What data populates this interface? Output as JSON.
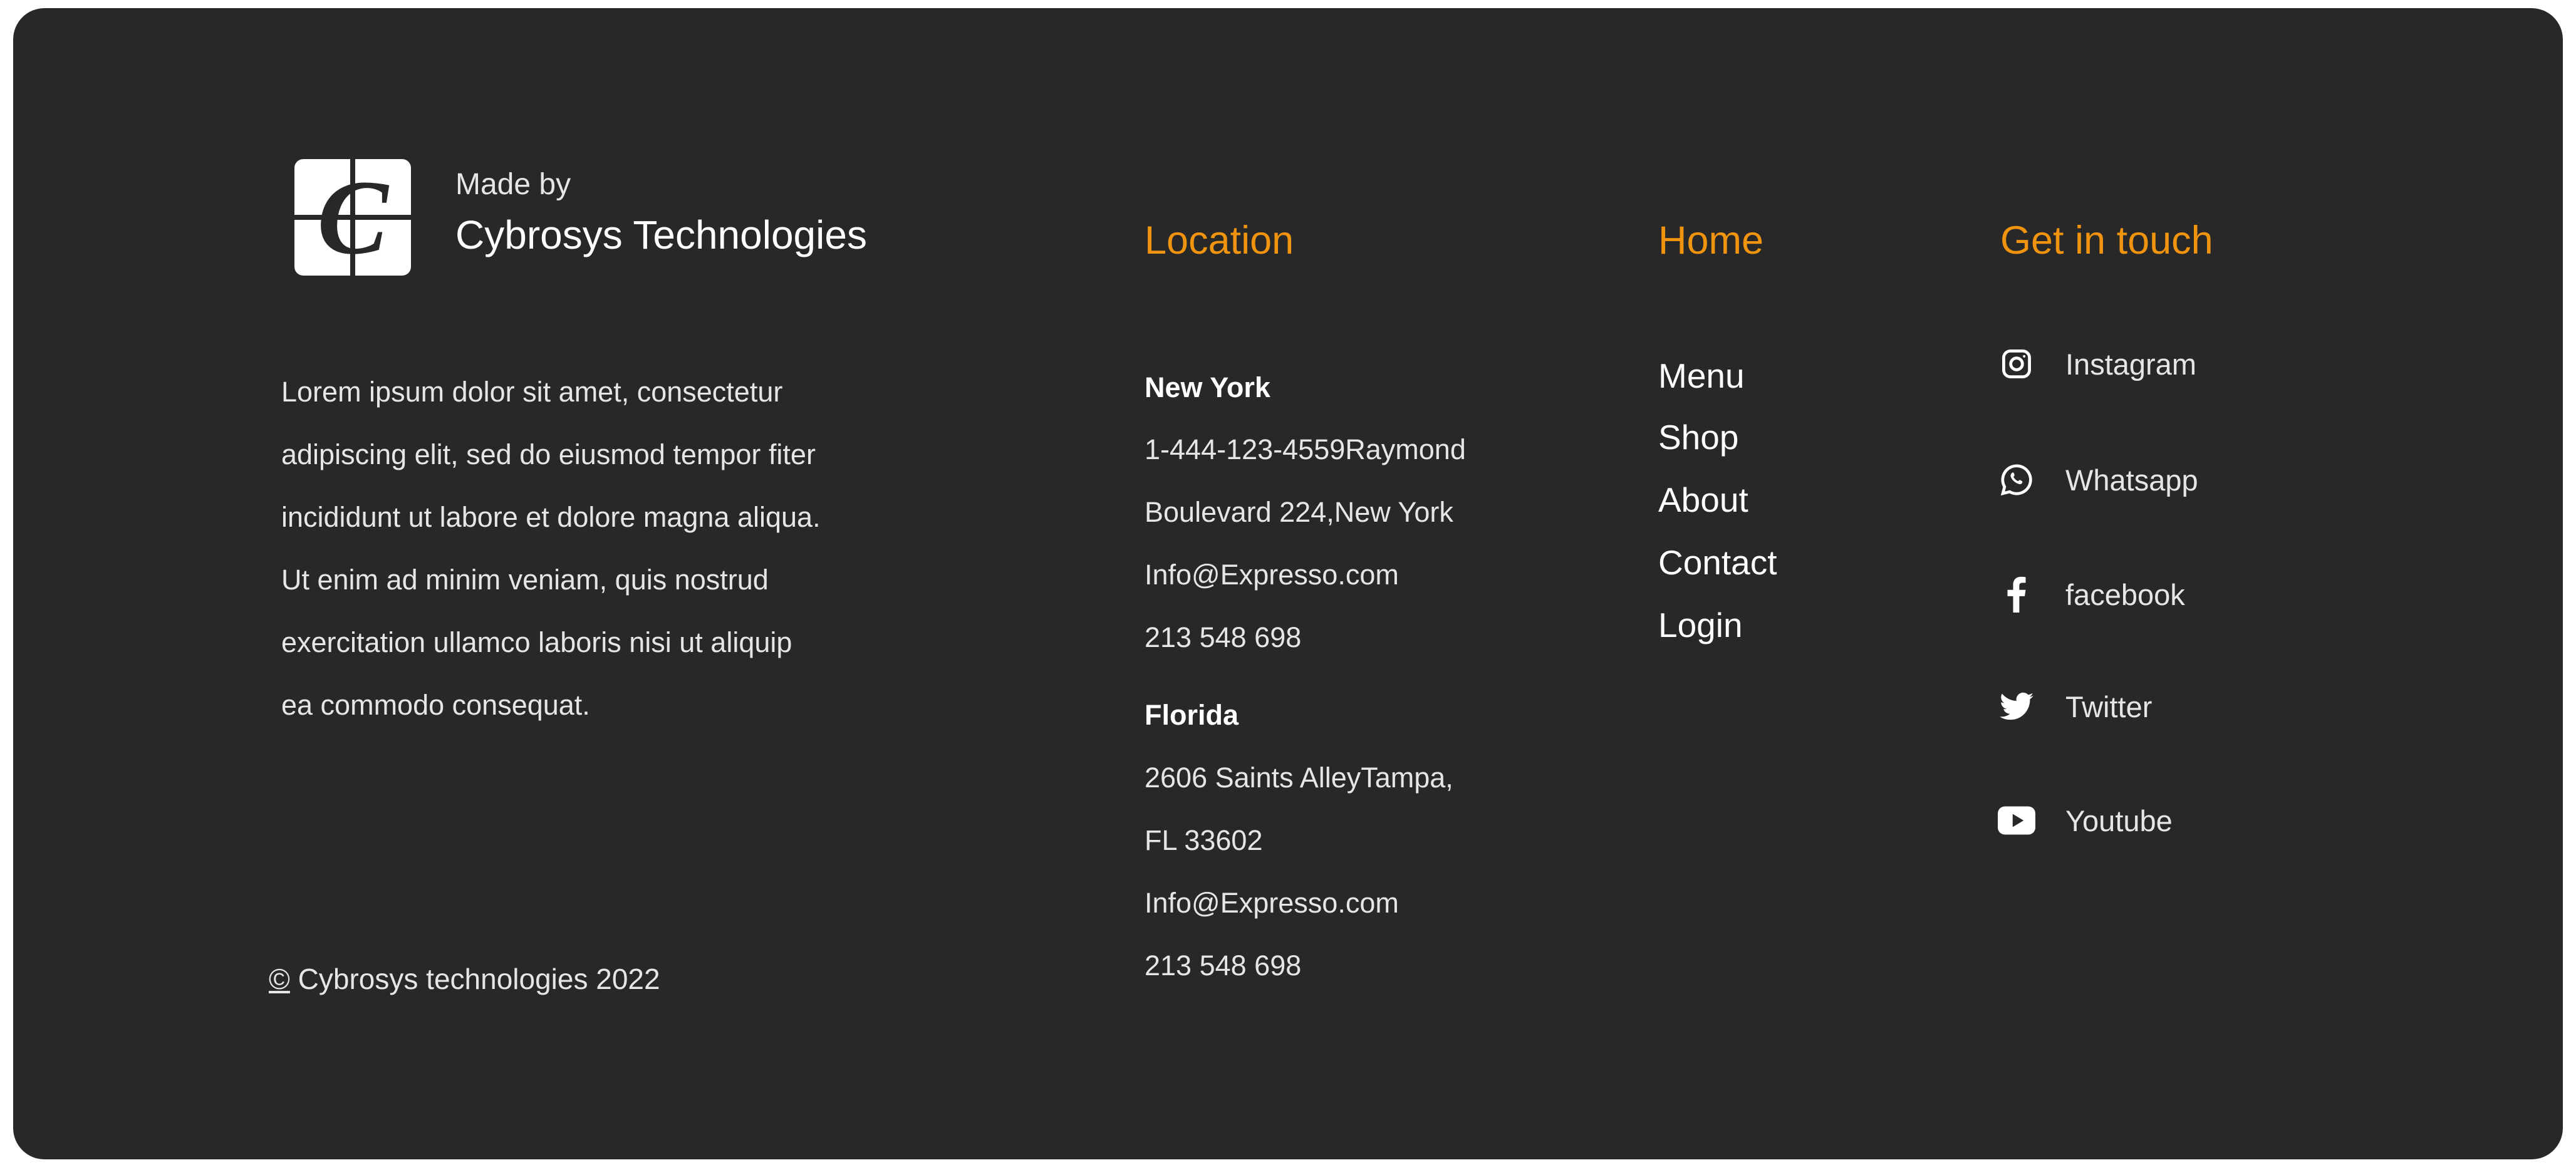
{
  "brand": {
    "made_by": "Made by",
    "name": "Cybrosys Technologies",
    "logo_letter": "C"
  },
  "about": {
    "lines": [
      "Lorem ipsum dolor sit amet, consectetur",
      "adipiscing elit, sed do eiusmod tempor fiter",
      "incididunt ut labore et dolore magna aliqua.",
      "Ut enim ad minim veniam, quis nostrud",
      "exercitation ullamco laboris nisi ut aliquip",
      "ea commodo consequat."
    ]
  },
  "copyright": {
    "symbol": "©",
    "text": " Cybrosys technologies 2022"
  },
  "location": {
    "title": "Location",
    "offices": [
      {
        "city": "New York",
        "lines": [
          "1-444-123-4559Raymond",
          "Boulevard 224,New York",
          "Info@Expresso.com",
          "213 548 698"
        ]
      },
      {
        "city": "Florida",
        "lines": [
          "2606 Saints AlleyTampa,",
          "FL 33602",
          "Info@Expresso.com",
          "213 548 698"
        ]
      }
    ]
  },
  "home": {
    "title": "Home",
    "links": [
      "Menu",
      "Shop",
      "About",
      "Contact",
      "Login"
    ]
  },
  "get_in_touch": {
    "title": "Get in touch",
    "items": [
      {
        "label": "Instagram",
        "icon": "instagram-icon"
      },
      {
        "label": "Whatsapp",
        "icon": "whatsapp-icon"
      },
      {
        "label": "facebook",
        "icon": "facebook-icon"
      },
      {
        "label": "Twitter",
        "icon": "twitter-icon"
      },
      {
        "label": "Youtube",
        "icon": "youtube-icon"
      }
    ]
  },
  "colors": {
    "background": "#282828",
    "accent": "#f0940f",
    "text": "#e6e6e6",
    "page": "#ffffff"
  }
}
